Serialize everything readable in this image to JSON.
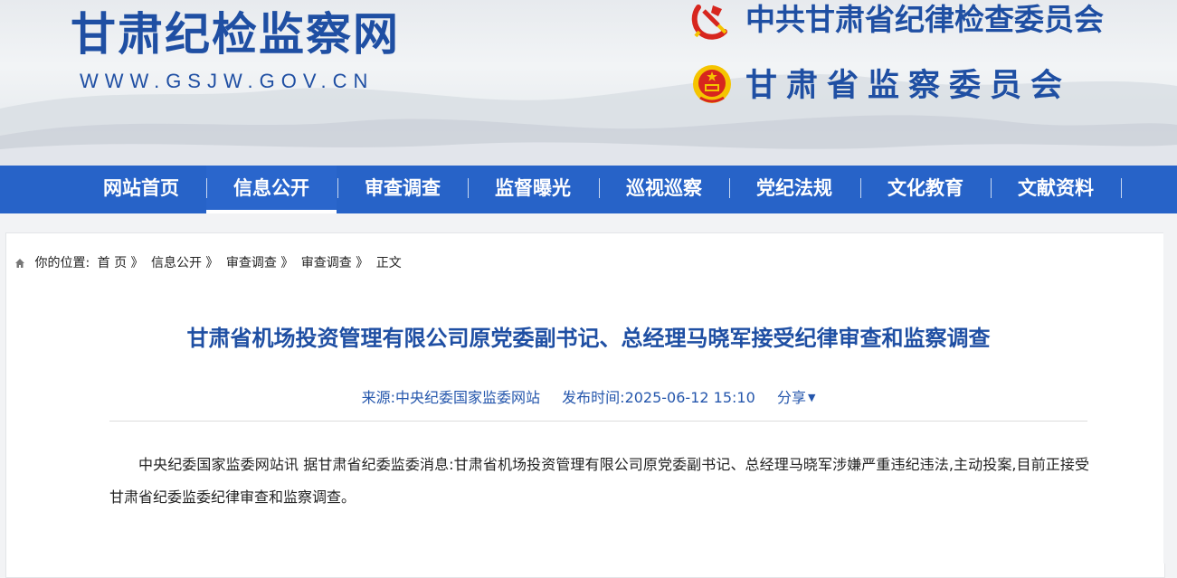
{
  "header": {
    "site_title": "甘肃纪检监察网",
    "site_url": "WWW.GSJW.GOV.CN",
    "org_party": "中共甘肃省纪律检查委员会",
    "org_supervision": "甘肃省监察委员会"
  },
  "nav": {
    "items": [
      {
        "label": "网站首页"
      },
      {
        "label": "信息公开",
        "active": true
      },
      {
        "label": "审查调查"
      },
      {
        "label": "监督曝光"
      },
      {
        "label": "巡视巡察"
      },
      {
        "label": "党纪法规"
      },
      {
        "label": "文化教育"
      },
      {
        "label": "文献资料"
      }
    ]
  },
  "breadcrumb": {
    "icon": "home-icon",
    "prefix": "你的位置:",
    "crumbs": [
      "首 页 》",
      "信息公开 》",
      "审查调查 》",
      "审查调查 》",
      "正文"
    ]
  },
  "article": {
    "title": "甘肃省机场投资管理有限公司原党委副书记、总经理马晓军接受纪律审查和监察调查",
    "source": "来源:中央纪委国家监委网站",
    "published": "发布时间:2025-06-12 15:10",
    "share_label": "分享",
    "body": "中央纪委国家监委网站讯 据甘肃省纪委监委消息:甘肃省机场投资管理有限公司原党委副书记、总经理马晓军涉嫌严重违纪违法,主动投案,目前正接受甘肃省纪委监委纪律审查和监察调查。"
  },
  "colors": {
    "brand_blue": "#1f4fa3",
    "nav_blue": "#2763c8",
    "emblem_red": "#d7261e",
    "emblem_gold": "#f5c400"
  }
}
